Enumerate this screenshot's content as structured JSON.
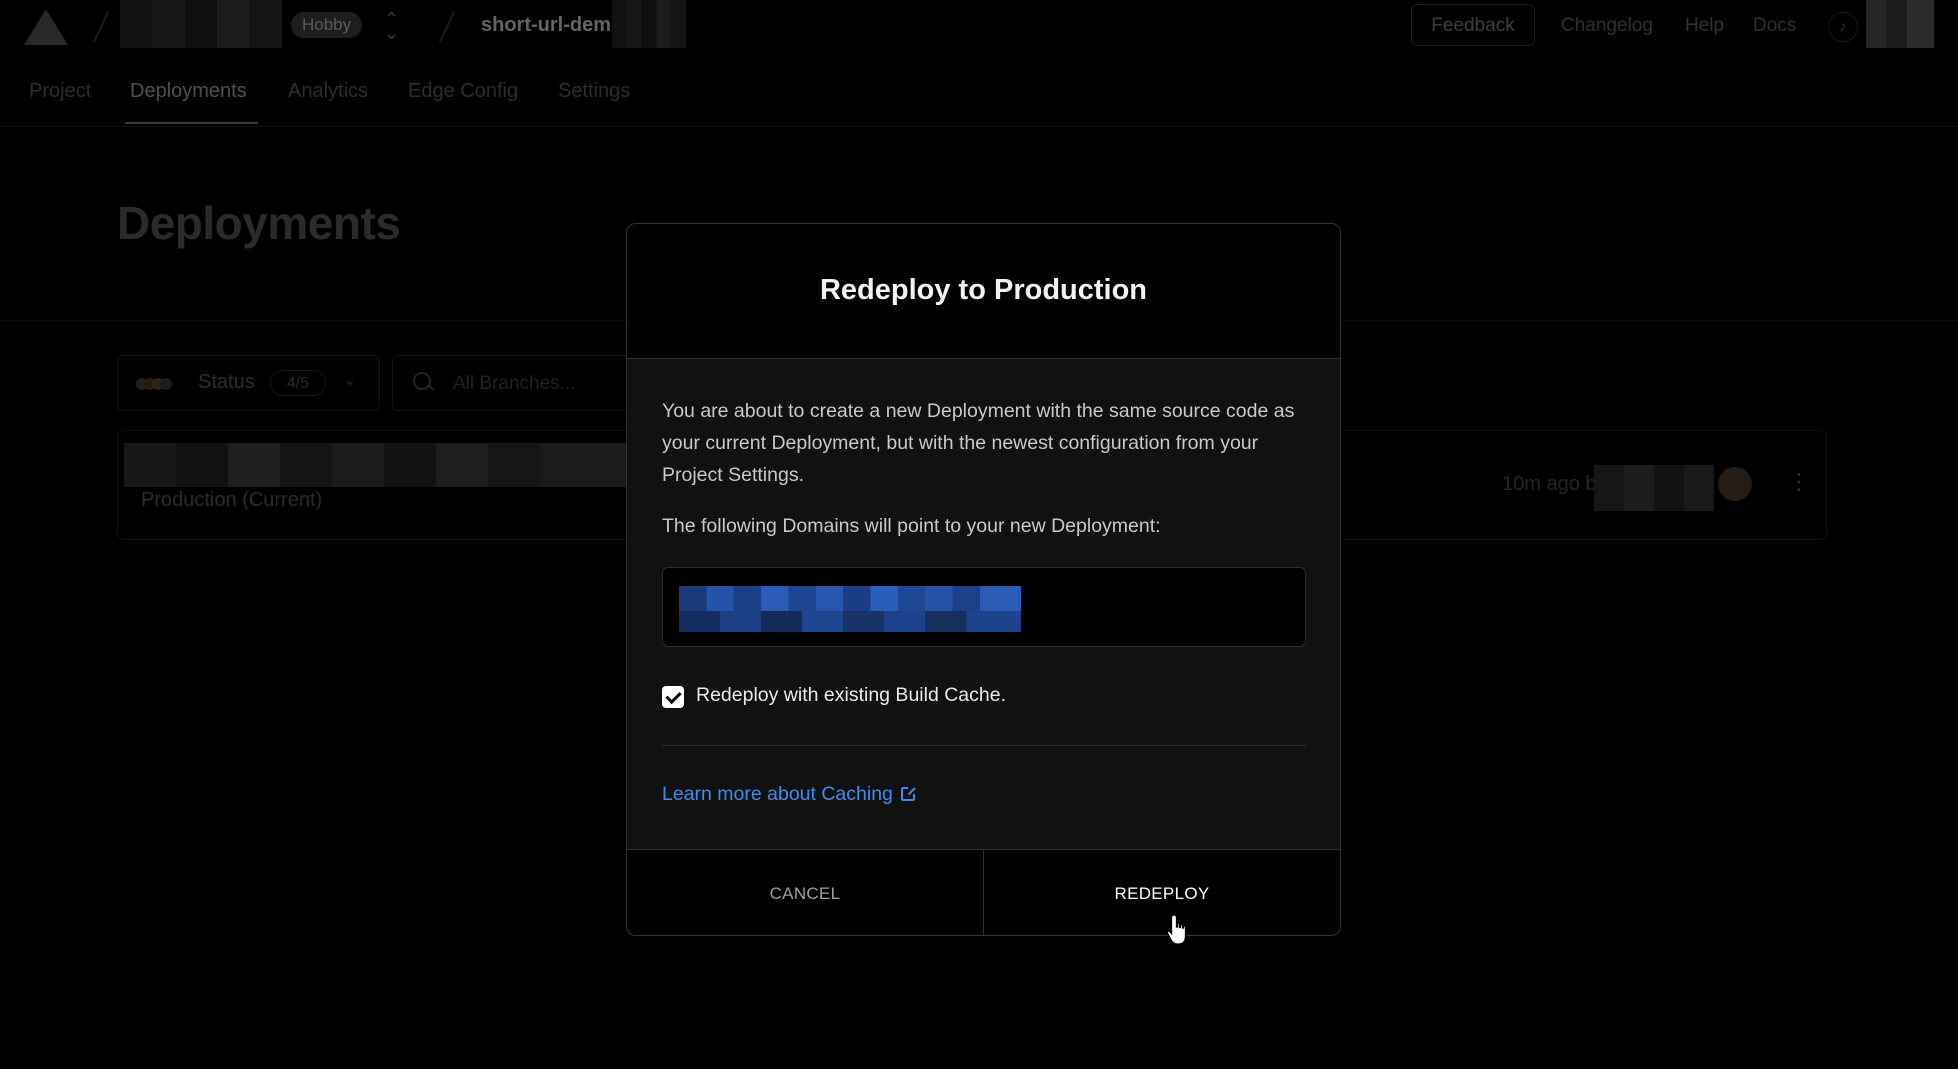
{
  "topbar": {
    "plan_badge": "Hobby",
    "project_name": "short-url-dem",
    "feedback_label": "Feedback",
    "links": [
      "Changelog",
      "Help",
      "Docs"
    ]
  },
  "tabs": [
    "Project",
    "Deployments",
    "Analytics",
    "Edge Config",
    "Settings"
  ],
  "active_tab": "Deployments",
  "page": {
    "title": "Deployments"
  },
  "filters": {
    "status_label": "Status",
    "status_count": "4/5",
    "branch_placeholder": "All Branches..."
  },
  "deployment_row": {
    "environment": "Production (Current)",
    "time": "10m ago b"
  },
  "modal": {
    "title": "Redeploy to Production",
    "description": "You are about to create a new Deployment with the same source code as your current Deployment, but with the newest configuration from your Project Settings.",
    "domains_label": "The following Domains will point to your new Deployment:",
    "checkbox_label": "Redeploy with existing Build Cache.",
    "checkbox_checked": true,
    "learn_more": "Learn more about Caching",
    "cancel_label": "CANCEL",
    "redeploy_label": "REDEPLOY"
  },
  "colors": {
    "background": "#000000",
    "link": "#3b8cf0",
    "border": "#2e2e2e"
  }
}
